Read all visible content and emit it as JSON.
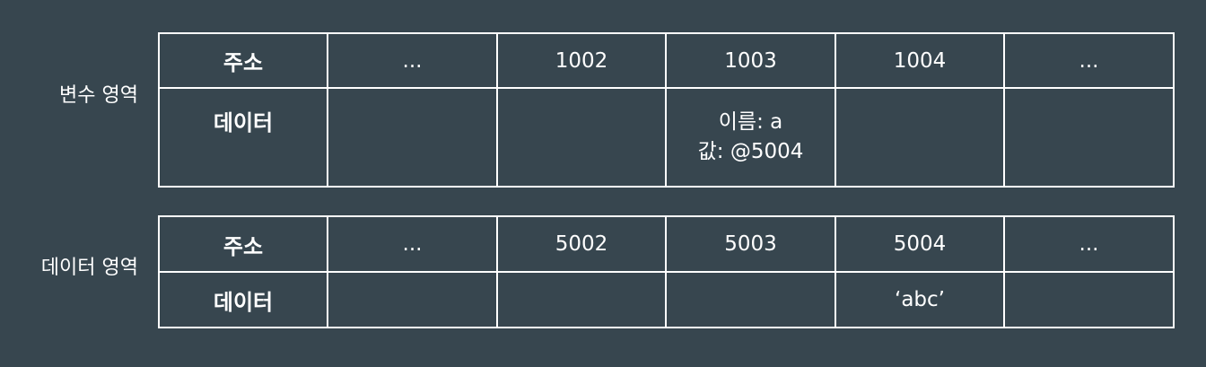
{
  "variable_area": {
    "label": "변수 영역",
    "row_headers": {
      "address": "주소",
      "data": "데이터"
    },
    "addresses": [
      "...",
      "1002",
      "1003",
      "1004",
      "..."
    ],
    "cells": [
      [],
      [],
      [
        "이름: a",
        "값: @5004"
      ],
      [],
      []
    ]
  },
  "data_area": {
    "label": "데이터 영역",
    "row_headers": {
      "address": "주소",
      "data": "데이터"
    },
    "addresses": [
      "...",
      "5002",
      "5003",
      "5004",
      "..."
    ],
    "cells": [
      [],
      [],
      [],
      [
        "‘abc’"
      ],
      []
    ]
  },
  "colors": {
    "background": "#37464f",
    "grid": "#ffffff",
    "text": "#ffffff"
  }
}
